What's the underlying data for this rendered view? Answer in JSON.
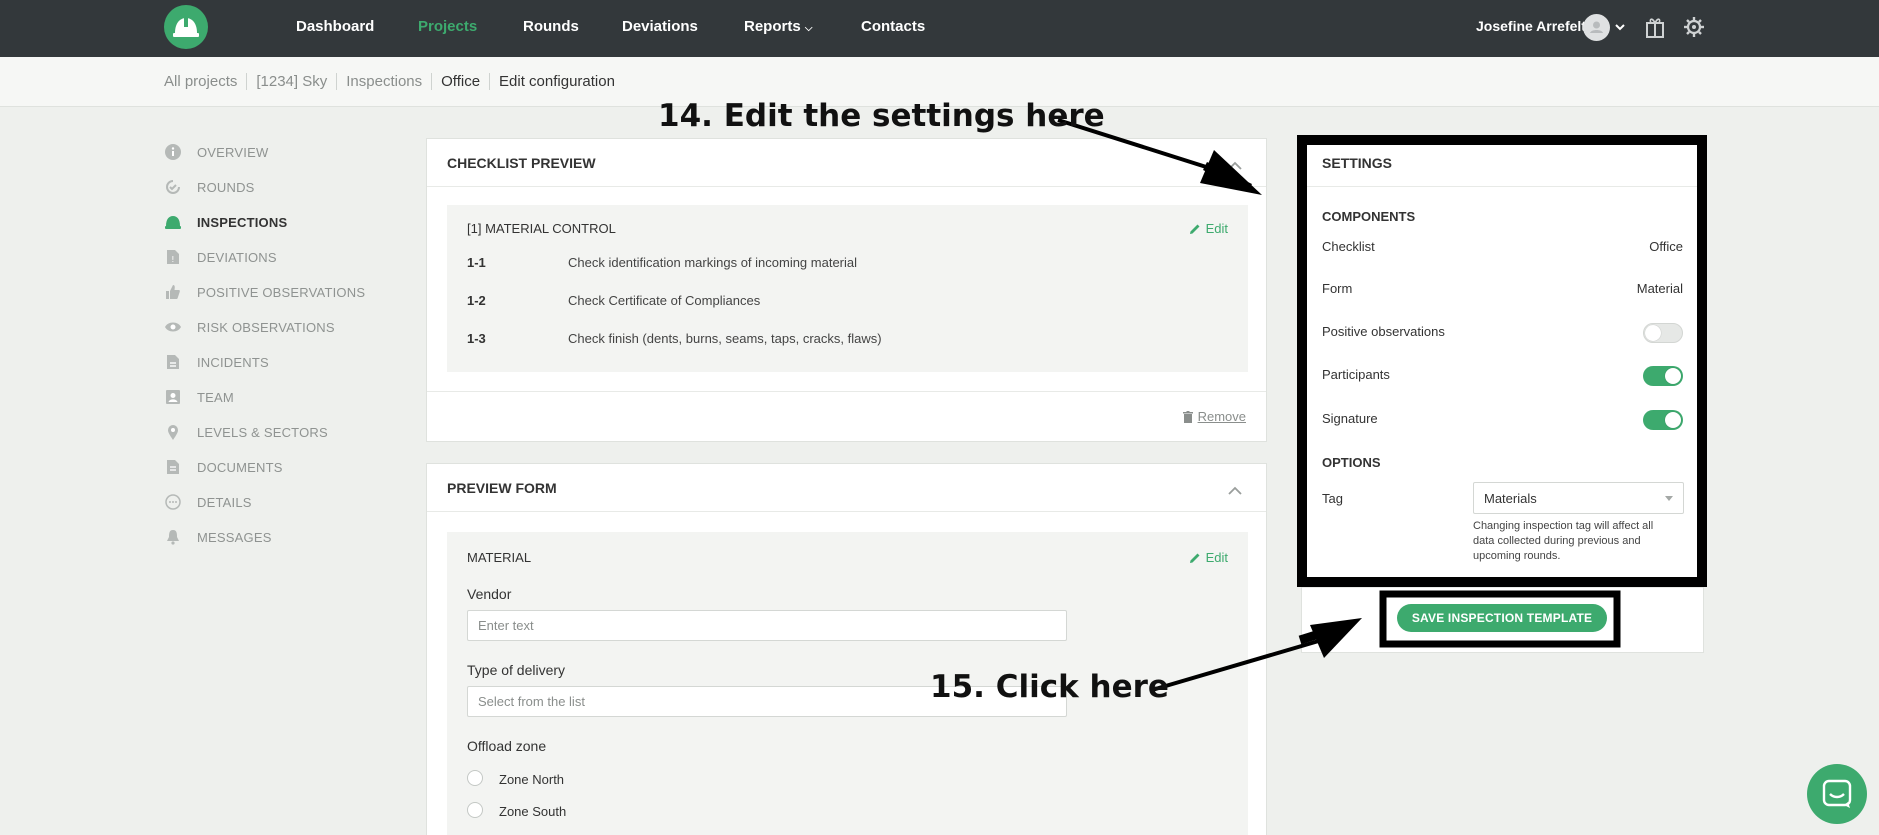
{
  "nav": {
    "links": [
      "Dashboard",
      "Projects",
      "Rounds",
      "Deviations",
      "Reports",
      "Contacts"
    ],
    "user_name": "Josefine Arrefelt"
  },
  "breadcrumb": [
    "All projects",
    "[1234] Sky",
    "Inspections",
    "Office",
    "Edit configuration"
  ],
  "sidebar": {
    "items": [
      {
        "label": "OVERVIEW",
        "icon": "info-icon"
      },
      {
        "label": "ROUNDS",
        "icon": "rounds-icon"
      },
      {
        "label": "INSPECTIONS",
        "icon": "helmet-icon"
      },
      {
        "label": "DEVIATIONS",
        "icon": "deviation-icon"
      },
      {
        "label": "POSITIVE OBSERVATIONS",
        "icon": "thumbs-up-icon"
      },
      {
        "label": "RISK OBSERVATIONS",
        "icon": "eye-icon"
      },
      {
        "label": "INCIDENTS",
        "icon": "incident-icon"
      },
      {
        "label": "TEAM",
        "icon": "team-icon"
      },
      {
        "label": "LEVELS & SECTORS",
        "icon": "location-pin-icon"
      },
      {
        "label": "DOCUMENTS",
        "icon": "document-icon"
      },
      {
        "label": "DETAILS",
        "icon": "details-icon"
      },
      {
        "label": "MESSAGES",
        "icon": "bell-icon"
      }
    ]
  },
  "checklist": {
    "title": "CHECKLIST PREVIEW",
    "section": "[1] MATERIAL CONTROL",
    "edit": "Edit",
    "rows": [
      {
        "num": "1-1",
        "text": "Check identification markings of incoming material"
      },
      {
        "num": "1-2",
        "text": "Check Certificate of Compliances"
      },
      {
        "num": "1-3",
        "text": "Check finish (dents, burns, seams, taps, cracks, flaws)"
      }
    ],
    "remove": "Remove"
  },
  "form": {
    "title": "PREVIEW FORM",
    "section": "MATERIAL",
    "edit": "Edit",
    "vendor_label": "Vendor",
    "vendor_placeholder": "Enter text",
    "delivery_label": "Type of delivery",
    "delivery_placeholder": "Select from the list",
    "offload_label": "Offload zone",
    "options": [
      "Zone North",
      "Zone South"
    ]
  },
  "settings": {
    "title": "SETTINGS",
    "components_heading": "COMPONENTS",
    "checklist_label": "Checklist",
    "checklist_value": "Office",
    "form_label": "Form",
    "form_value": "Material",
    "positive_label": "Positive observations",
    "positive_on": false,
    "participants_label": "Participants",
    "participants_on": true,
    "signature_label": "Signature",
    "signature_on": true,
    "options_heading": "OPTIONS",
    "tag_label": "Tag",
    "tag_value": "Materials",
    "tag_help": "Changing inspection tag will affect all data collected during previous and upcoming rounds.",
    "save_button": "SAVE INSPECTION TEMPLATE"
  },
  "annotations": {
    "step14": "14. Edit the settings here",
    "step15": "15. Click here"
  },
  "colors": {
    "accent": "#3daa6e",
    "topbar": "#33383b",
    "background": "#eef0ed"
  }
}
